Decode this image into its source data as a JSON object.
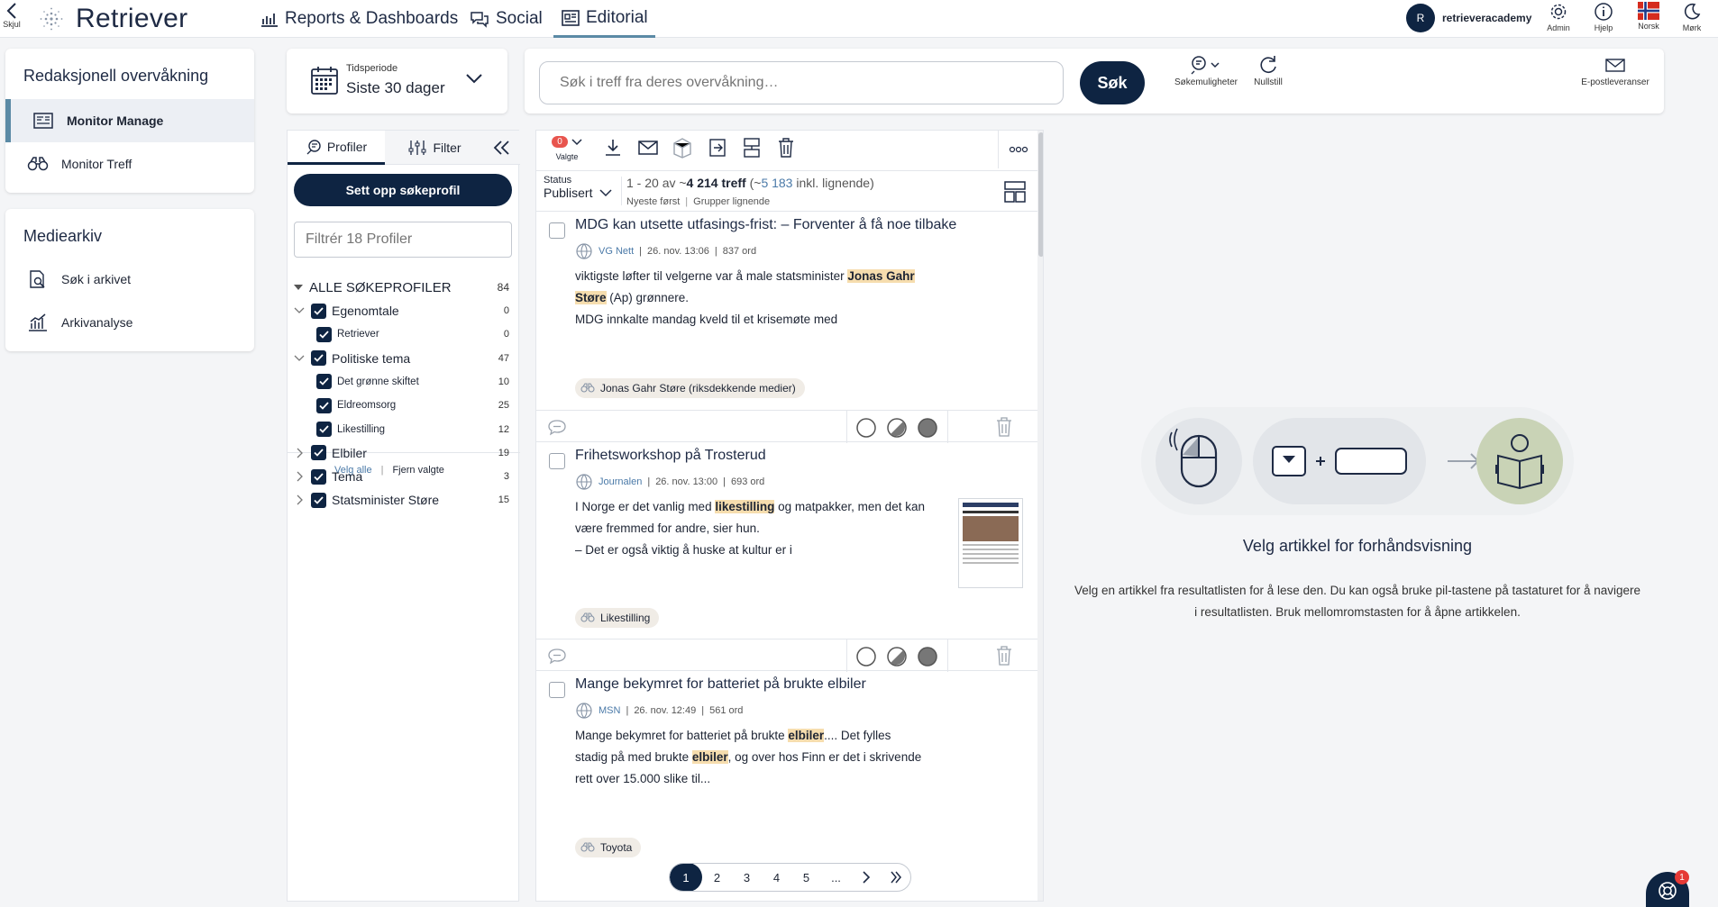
{
  "topbar": {
    "hide_label": "Skjul",
    "logo_text": "Retriever",
    "nav": [
      {
        "label": "Reports & Dashboards",
        "icon": "bar-chart-icon"
      },
      {
        "label": "Social",
        "icon": "chat-bubbles-icon"
      },
      {
        "label": "Editorial",
        "icon": "newspaper-icon",
        "active": true
      }
    ],
    "user": {
      "initial": "R",
      "name": "retrieveracademy"
    },
    "icons": [
      {
        "label": "Admin",
        "icon": "gear-icon"
      },
      {
        "label": "Hjelp",
        "icon": "info-icon"
      },
      {
        "label": "Norsk",
        "icon": "norway-flag-icon"
      },
      {
        "label": "Mørk",
        "icon": "moon-icon"
      }
    ]
  },
  "sidebar": {
    "section1": {
      "title": "Redaksjonell overvåkning",
      "items": [
        {
          "label": "Monitor Manage",
          "icon": "monitor-manage-icon",
          "active": true
        },
        {
          "label": "Monitor Treff",
          "icon": "binoculars-icon"
        }
      ]
    },
    "section2": {
      "title": "Mediearkiv",
      "items": [
        {
          "label": "Søk i arkivet",
          "icon": "document-search-icon"
        },
        {
          "label": "Arkivanalyse",
          "icon": "analysis-chart-icon"
        }
      ]
    }
  },
  "period": {
    "label": "Tidsperiode",
    "value": "Siste 30 dager"
  },
  "search": {
    "placeholder": "Søk i treff fra deres overvåkning…",
    "button": "Søk",
    "options_label": "Søkemuligheter",
    "reset_label": "Nullstill",
    "email_label": "E-postleveranser"
  },
  "profiles": {
    "tab_profiles": "Profiler",
    "tab_filter": "Filter",
    "setup_button": "Sett opp søkeprofil",
    "filter_placeholder": "Filtrér 18 Profiler",
    "root": {
      "label": "ALLE SØKEPROFILER",
      "count": "84"
    },
    "tree": [
      {
        "label": "Egenomtale",
        "count": "0",
        "level": 1,
        "expanded": true
      },
      {
        "label": "Retriever",
        "count": "0",
        "level": 2
      },
      {
        "label": "Politiske tema",
        "count": "47",
        "level": 1,
        "expanded": true
      },
      {
        "label": "Det grønne skiftet",
        "count": "10",
        "level": 2
      },
      {
        "label": "Eldreomsorg",
        "count": "25",
        "level": 2
      },
      {
        "label": "Likestilling",
        "count": "12",
        "level": 2
      },
      {
        "label": "Elbiler",
        "count": "19",
        "level": 1,
        "expanded": false
      },
      {
        "label": "Tema",
        "count": "3",
        "level": 1,
        "expanded": false
      },
      {
        "label": "Statsminister Støre",
        "count": "15",
        "level": 1,
        "expanded": false
      }
    ],
    "select_all": "Velg alle",
    "remove_selected": "Fjern valgte"
  },
  "results": {
    "selected_count": "0",
    "selected_label": "Valgte",
    "status_label": "Status",
    "status_value": "Publisert",
    "range_text": "1 - 20 av ~",
    "total_text": "4 214 treff",
    "similar_open": " (~",
    "similar_count": "5 183",
    "similar_text": " inkl. lignende)",
    "sort_newest": "Nyeste først",
    "group_similar": "Grupper lignende",
    "articles": [
      {
        "title": "MDG kan utsette utfasings-frist: – Forventer å få noe tilbake",
        "source": "VG Nett",
        "date": "26. nov. 13:06",
        "words": "837 ord",
        "snip1a": "viktigste løfter til velgerne var å male statsminister ",
        "snip1hl": "Jonas Gahr",
        "snip2hl": "Støre",
        "snip2b": " (Ap) grønnere.",
        "snip3": "MDG innkalte mandag kveld til et krisemøte med",
        "tag": "Jonas Gahr Støre (riksdekkende medier)"
      },
      {
        "title": "Frihetsworkshop på Trosterud",
        "source": "Journalen",
        "date": "26. nov. 13:00",
        "words": "693 ord",
        "snip1a": "I Norge er det vanlig med ",
        "snip1hl": "likestilling",
        "snip1b": " og matpakker, men det kan",
        "snip2": "være fremmed for andre, sier hun.",
        "snip3": "– Det er også viktig å huske at kultur er i",
        "tag": "Likestilling"
      },
      {
        "title": "Mange bekymret for batteriet på brukte elbiler",
        "source": "MSN",
        "date": "26. nov. 12:49",
        "words": "561 ord",
        "snip1a": "Mange bekymret for batteriet på brukte ",
        "snip1hl": "elbiler",
        "snip1b": ".... Det fylles",
        "snip2a": "stadig på med brukte ",
        "snip2hl": "elbiler",
        "snip2b": ", og over hos Finn er det i skrivende",
        "snip3": "rett over 15.000 slike til...",
        "tag": "Toyota"
      }
    ],
    "pages": [
      "1",
      "2",
      "3",
      "4",
      "5",
      "..."
    ]
  },
  "preview": {
    "title": "Velg artikkel for forhåndsvisning",
    "text1": "Velg en artikkel fra resultatlisten for å lese den. Du kan også bruke pil-tastene på tastaturet for å navigere",
    "text2": "i resultatlisten. Bruk mellomromstasten for å åpne artikkelen."
  },
  "chat": {
    "badge": "1"
  },
  "colors": {
    "navy": "#0e2442",
    "accent": "#5b8aa5",
    "highlight": "#f6ddae",
    "link": "#4b7aa8"
  }
}
